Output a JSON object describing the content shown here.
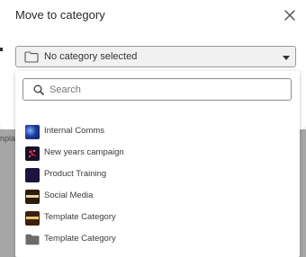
{
  "background": {
    "partial_text": "nplat"
  },
  "modal": {
    "title": "Move to category",
    "select": {
      "value": "No category selected"
    },
    "dropdown": {
      "search_placeholder": "Search",
      "search_value": "",
      "items": [
        {
          "label": "Internal Comms",
          "thumb": "image"
        },
        {
          "label": "New years campaign",
          "thumb": "image"
        },
        {
          "label": "Product Training",
          "thumb": "image"
        },
        {
          "label": "Social Media",
          "thumb": "image"
        },
        {
          "label": "Template Category",
          "thumb": "image"
        },
        {
          "label": "Template Category",
          "thumb": "folder-icon"
        }
      ]
    }
  },
  "colors": {
    "overlay": "#a6a6a6",
    "modal_bg": "#ffffff",
    "select_bg": "#f1f1f1",
    "folder_icon": "#6b6b6b"
  }
}
